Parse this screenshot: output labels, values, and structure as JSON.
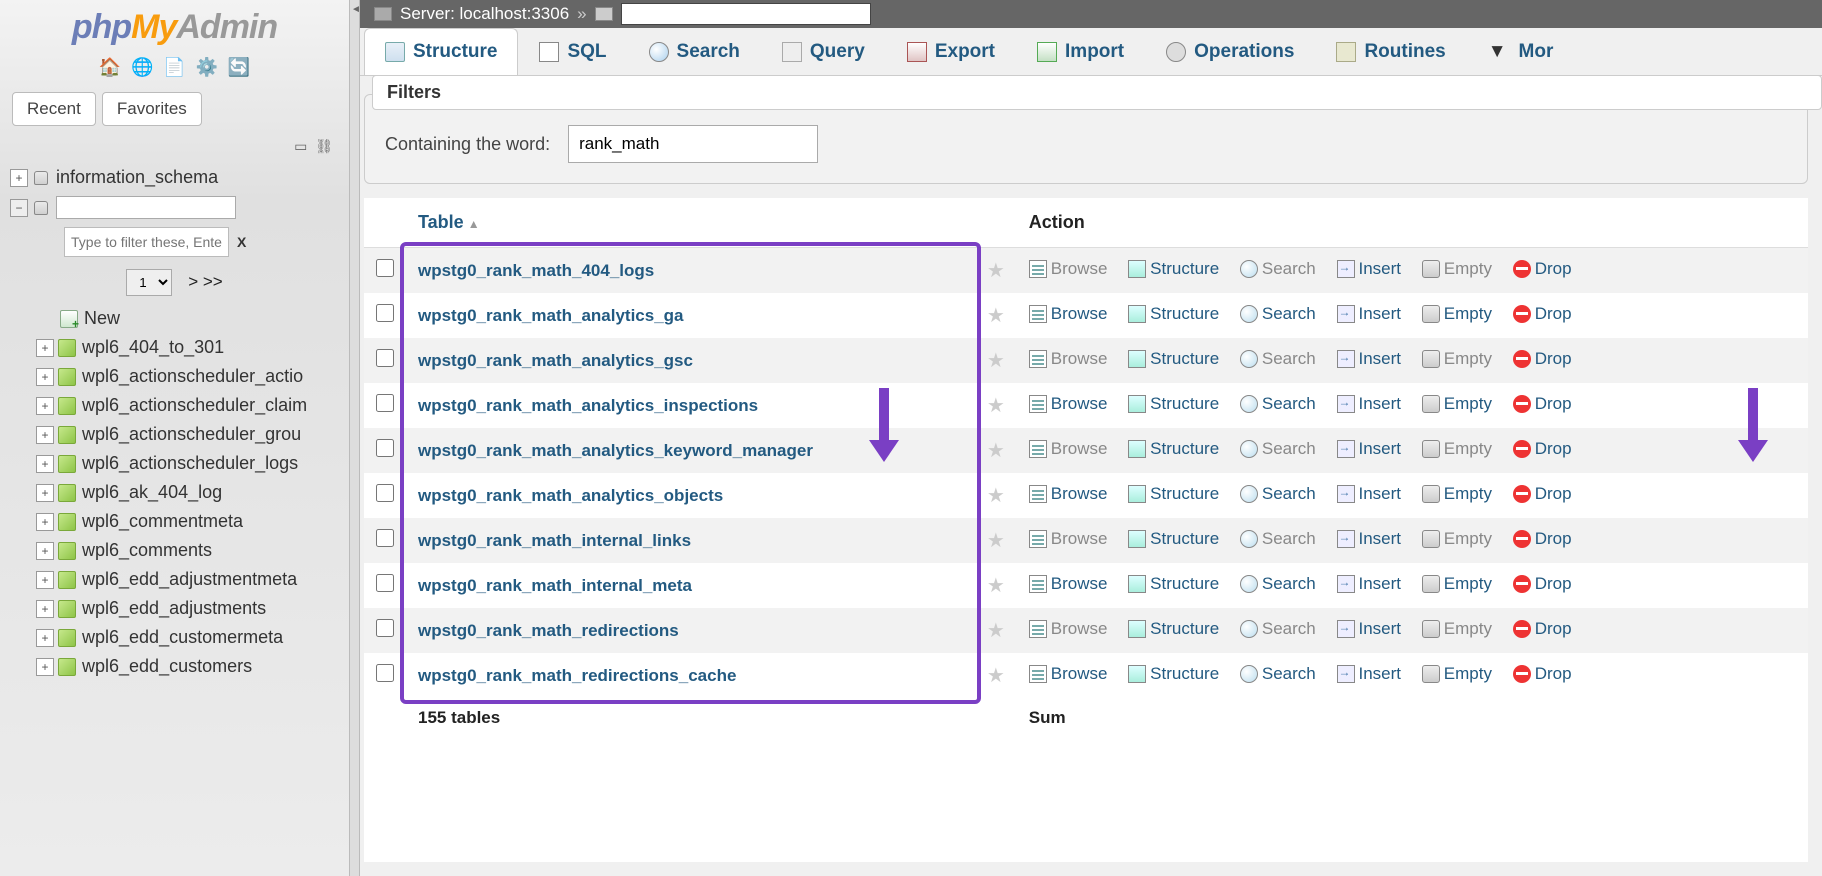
{
  "logo": {
    "php": "php",
    "my": "My",
    "admin": "Admin"
  },
  "sidebar": {
    "tabs": {
      "recent": "Recent",
      "favorites": "Favorites"
    },
    "db_top": "information_schema",
    "filter_placeholder": "Type to filter these, Enter to",
    "filter_x": "X",
    "pager": {
      "page": "1",
      "next": "> >>"
    },
    "new_label": "New",
    "tables": [
      "wpl6_404_to_301",
      "wpl6_actionscheduler_actio",
      "wpl6_actionscheduler_claim",
      "wpl6_actionscheduler_grou",
      "wpl6_actionscheduler_logs",
      "wpl6_ak_404_log",
      "wpl6_commentmeta",
      "wpl6_comments",
      "wpl6_edd_adjustmentmeta",
      "wpl6_edd_adjustments",
      "wpl6_edd_customermeta",
      "wpl6_edd_customers"
    ]
  },
  "breadcrumb": {
    "server_label": "Server: localhost:3306",
    "sep": "»"
  },
  "tabs": {
    "structure": "Structure",
    "sql": "SQL",
    "search": "Search",
    "query": "Query",
    "export": "Export",
    "import": "Import",
    "operations": "Operations",
    "routines": "Routines",
    "more": "Mor"
  },
  "filters": {
    "heading": "Filters",
    "label": "Containing the word:",
    "value": "rank_math"
  },
  "columns": {
    "table": "Table",
    "action": "Action"
  },
  "actions": {
    "browse": "Browse",
    "structure": "Structure",
    "search": "Search",
    "insert": "Insert",
    "empty": "Empty",
    "drop": "Drop"
  },
  "rows": [
    "wpstg0_rank_math_404_logs",
    "wpstg0_rank_math_analytics_ga",
    "wpstg0_rank_math_analytics_gsc",
    "wpstg0_rank_math_analytics_inspections",
    "wpstg0_rank_math_analytics_keyword_manager",
    "wpstg0_rank_math_analytics_objects",
    "wpstg0_rank_math_internal_links",
    "wpstg0_rank_math_internal_meta",
    "wpstg0_rank_math_redirections",
    "wpstg0_rank_math_redirections_cache"
  ],
  "summary": {
    "count": "155 tables",
    "sum": "Sum"
  }
}
